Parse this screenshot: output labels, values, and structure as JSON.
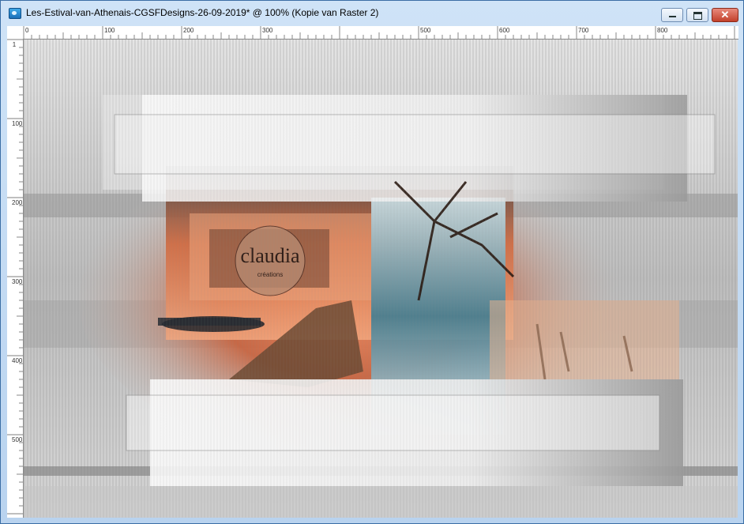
{
  "window": {
    "title": "Les-Estival-van-Athenais-CGSFDesigns-26-09-2019* @ 100% (Kopie van Raster 2)",
    "close_glyph": "✕",
    "controls": [
      "minimize-icon",
      "maximize-icon",
      "close-icon"
    ]
  },
  "ruler": {
    "horizontal_labels": [
      "0",
      "100",
      "200",
      "300",
      "500",
      "600",
      "700",
      "800"
    ],
    "vertical_labels": [
      "1",
      "100",
      "200",
      "300",
      "400",
      "500"
    ]
  },
  "image": {
    "watermark_text": "claudia",
    "watermark_subtext": "créations"
  },
  "colors": {
    "accent": "#c2412b",
    "frame": "#b9d3ef",
    "sky": "#e06b3c"
  }
}
